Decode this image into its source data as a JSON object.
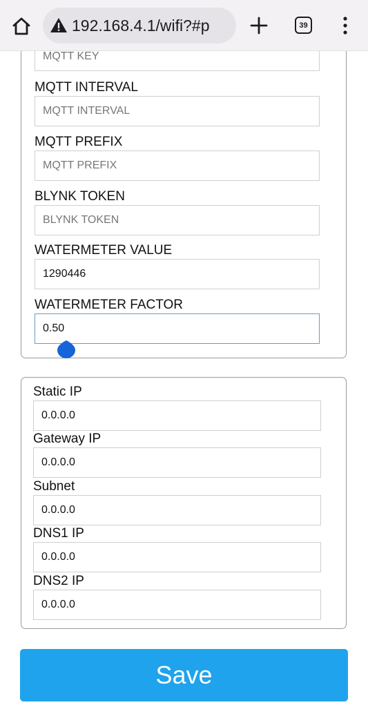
{
  "browser": {
    "url": "192.168.4.1/wifi?#p",
    "tab_count": "39"
  },
  "mqtt_section": {
    "mqtt_key_placeholder": "MQTT KEY",
    "mqtt_interval_label": "MQTT INTERVAL",
    "mqtt_interval_placeholder": "MQTT INTERVAL",
    "mqtt_prefix_label": "MQTT PREFIX",
    "mqtt_prefix_placeholder": "MQTT PREFIX",
    "blynk_token_label": "BLYNK TOKEN",
    "blynk_token_placeholder": "BLYNK TOKEN",
    "watermeter_value_label": "WATERMETER VALUE",
    "watermeter_value": "1290446",
    "watermeter_factor_label": "WATERMETER FACTOR",
    "watermeter_factor": "0.50"
  },
  "network_section": {
    "static_ip_label": "Static IP",
    "static_ip": "0.0.0.0",
    "gateway_ip_label": "Gateway IP",
    "gateway_ip": "0.0.0.0",
    "subnet_label": "Subnet",
    "subnet": "0.0.0.0",
    "dns1_label": "DNS1 IP",
    "dns1": "0.0.0.0",
    "dns2_label": "DNS2 IP",
    "dns2": "0.0.0.0"
  },
  "save_label": "Save",
  "colors": {
    "save_button": "#1fa3ec",
    "selection_handle": "#1565d8"
  },
  "icons": [
    "home-icon",
    "warning-icon",
    "new-tab-icon",
    "tab-switcher-icon",
    "menu-icon"
  ]
}
